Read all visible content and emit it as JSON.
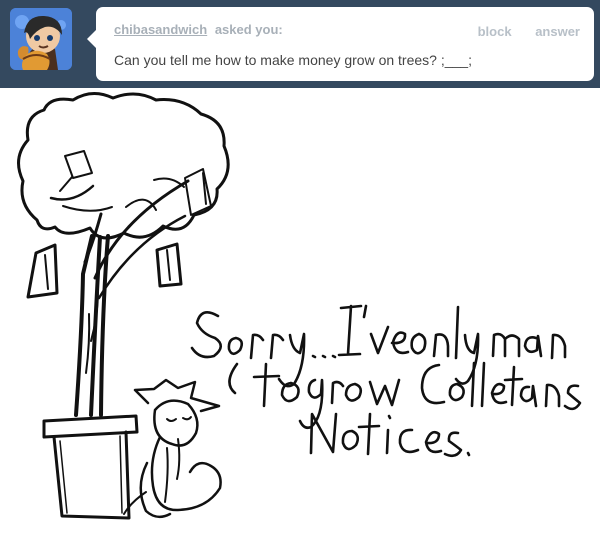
{
  "ask": {
    "asker": "chibasandwich",
    "asked_label": "asked you:",
    "question": "Can you tell me how to make money grow on trees? ;___;",
    "block_label": "block",
    "answer_label": "answer"
  },
  "colors": {
    "header_bg": "#34495f",
    "bubble_bg": "#ffffff",
    "muted_text": "#a8b0b8",
    "ink": "#111111"
  },
  "answer_drawing": {
    "handwritten_text": "Sorry... I've only managed to grow Colletans notices."
  }
}
